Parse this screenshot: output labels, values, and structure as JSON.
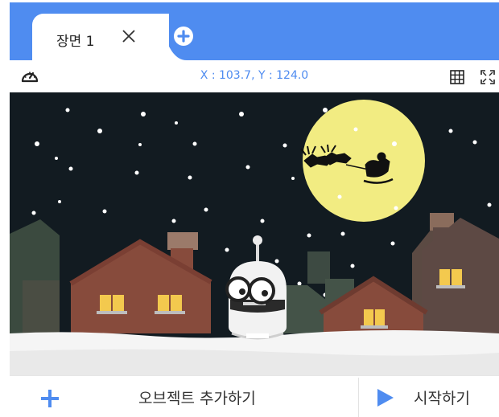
{
  "tab": {
    "title": "장면 1"
  },
  "toolbar": {
    "coordinates": "X : 103.7, Y : 124.0"
  },
  "bottom": {
    "add_object_label": "오브젝트 추가하기",
    "start_label": "시작하기"
  },
  "colors": {
    "accent": "#4f8cf0",
    "sky": "#121b21",
    "moon": "#f2ec82",
    "snow": "#f5f5f5"
  },
  "icons": [
    "close-icon",
    "add-tab-icon",
    "speed-icon",
    "grid-icon",
    "fullscreen-icon",
    "plus-icon",
    "play-icon"
  ]
}
